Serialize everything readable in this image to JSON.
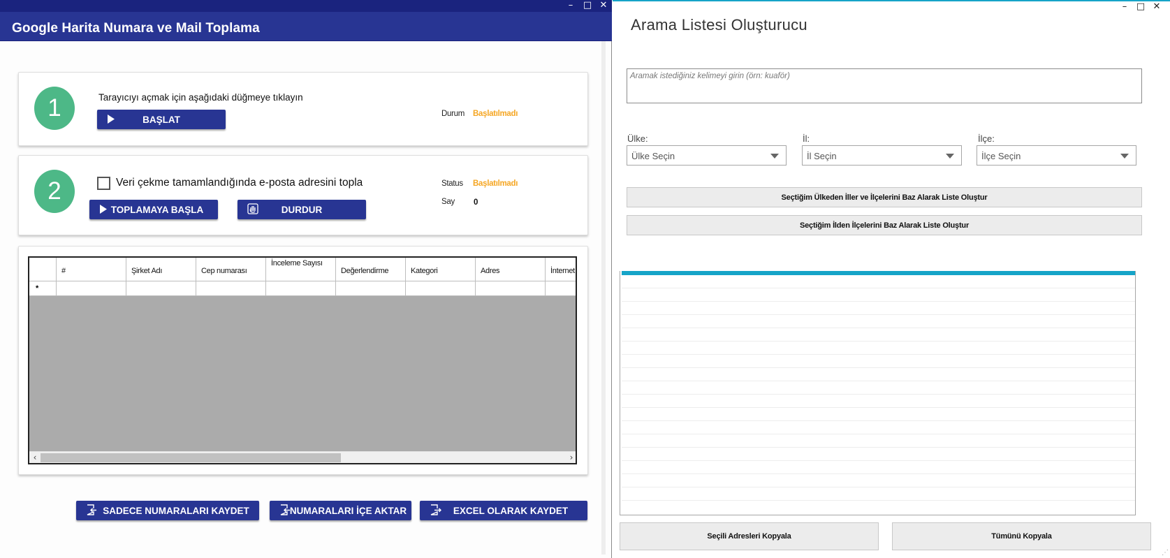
{
  "left_window": {
    "title": "Google Harita Numara ve Mail Toplama",
    "controls": {
      "minimize": "–",
      "maximize": "□",
      "close": "✕"
    },
    "step1": {
      "number": "1",
      "instruction": "Tarayıcıyı açmak için aşağıdaki düğmeye tıklayın",
      "start_button": "BAŞLAT",
      "status_label": "Durum",
      "status_value": "Başlatılmadı"
    },
    "step2": {
      "number": "2",
      "checkbox_label": "Veri çekme tamamlandığında e-posta adresini topla",
      "checkbox_checked": false,
      "collect_button": "TOPLAMAYA BAŞLA",
      "stop_button": "DURDUR",
      "status_label": "Status",
      "status_value": "Başlatılmadı",
      "count_label": "Say",
      "count_value": "0"
    },
    "grid": {
      "columns": [
        "#",
        "Şirket Adı",
        "Cep numarası",
        "İnceleme Sayısı",
        "Değerlendirme",
        "Kategori",
        "Adres",
        "İnternet"
      ],
      "new_row_marker": "*"
    },
    "buttons": {
      "save_numbers": "SADECE NUMARALARI KAYDET",
      "import_numbers": "NUMARALARI İÇE AKTAR",
      "save_excel": "EXCEL OLARAK KAYDET"
    },
    "colors": {
      "primary": "#283593",
      "title_bar": "#1a237e",
      "step_circle": "#4db887",
      "status_warning": "#f5a623"
    }
  },
  "right_window": {
    "title": "Arama Listesi Oluşturucu",
    "controls": {
      "minimize": "–",
      "maximize": "□",
      "close": "✕"
    },
    "search": {
      "placeholder": "Aramak istediğiniz kelimeyi girin (örn: kuaför)"
    },
    "country": {
      "label": "Ülke:",
      "value": "Ülke Seçin"
    },
    "province": {
      "label": "İl:",
      "value": "İl Seçin"
    },
    "district": {
      "label": "İlçe:",
      "value": "İlçe Seçin"
    },
    "btn_country_list": "Seçtiğim Ülkeden İller ve İlçelerini Baz Alarak Liste Oluştur",
    "btn_province_list": "Seçtiğim İlden İlçelerini Baz Alarak Liste Oluştur",
    "btn_copy_selected": "Seçili Adresleri Kopyala",
    "btn_copy_all": "Tümünü Kopyala",
    "colors": {
      "accent": "#16a4c8"
    }
  }
}
